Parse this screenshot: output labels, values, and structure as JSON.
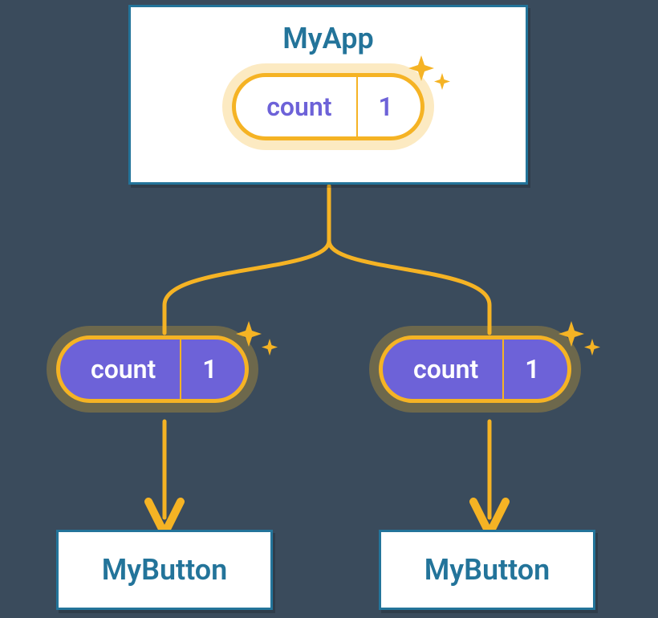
{
  "parent": {
    "name": "MyApp",
    "state_label": "count",
    "state_value": "1"
  },
  "props": {
    "left": {
      "label": "count",
      "value": "1"
    },
    "right": {
      "label": "count",
      "value": "1"
    }
  },
  "children": {
    "left": {
      "name": "MyButton"
    },
    "right": {
      "name": "MyButton"
    }
  },
  "colors": {
    "node_border": "#23749a",
    "accent": "#f5b324",
    "prop_fill": "#6d62d8"
  }
}
